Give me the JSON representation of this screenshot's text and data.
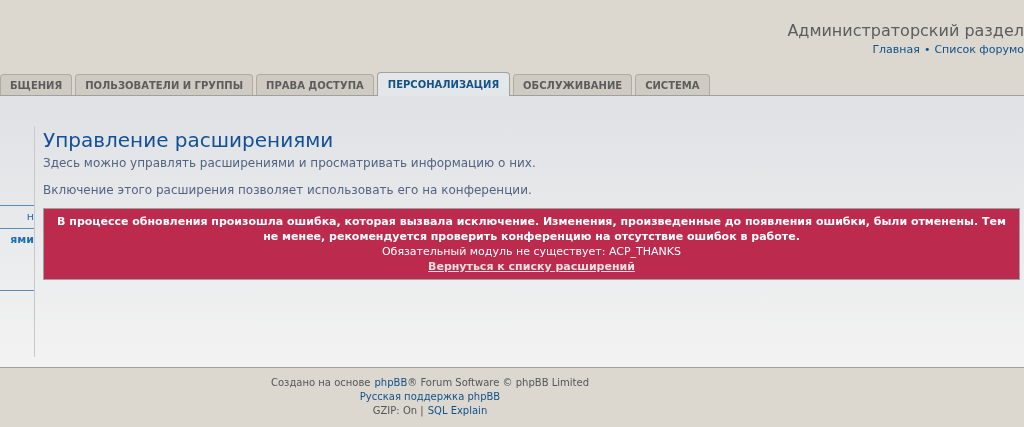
{
  "header": {
    "title": "Администраторский раздел",
    "separator": "•",
    "links": [
      "Главная",
      "Список форумо"
    ]
  },
  "tabs": [
    {
      "label": "БЩЕНИЯ",
      "selected": false
    },
    {
      "label": "ПОЛЬЗОВАТЕЛИ И ГРУППЫ",
      "selected": false
    },
    {
      "label": "ПРАВА ДОСТУПА",
      "selected": false
    },
    {
      "label": "ПЕРСОНАЛИЗАЦИЯ",
      "selected": true
    },
    {
      "label": "ОБСЛУЖИВАНИЕ",
      "selected": false
    },
    {
      "label": "СИСТЕМА",
      "selected": false
    }
  ],
  "sidebar": {
    "items": [
      {
        "label": "н",
        "selected": false
      },
      {
        "label": "ями",
        "selected": true
      }
    ]
  },
  "main": {
    "title": "Управление расширениями",
    "description": "Здесь можно управлять расширениями и просматривать информацию о них.",
    "note": "Включение этого расширения позволяет использовать его на конференции.",
    "error": {
      "message": "В процессе обновления произошла ошибка, которая вызвала исключение. Изменения, произведенные до появления ошибки, были отменены. Тем не менее, рекомендуется проверить конференцию на отсутствие ошибок в работе.",
      "detail": "Обязательный модуль не существует: ACP_THANKS",
      "link": "Вернуться к списку расширений"
    }
  },
  "footer": {
    "line1": [
      "Создано на основе",
      "phpBB",
      "® Forum Software © phpBB Limited"
    ],
    "line2": "Русская поддержка phpBB",
    "line3": [
      "GZIP: On |",
      "SQL Explain"
    ]
  }
}
